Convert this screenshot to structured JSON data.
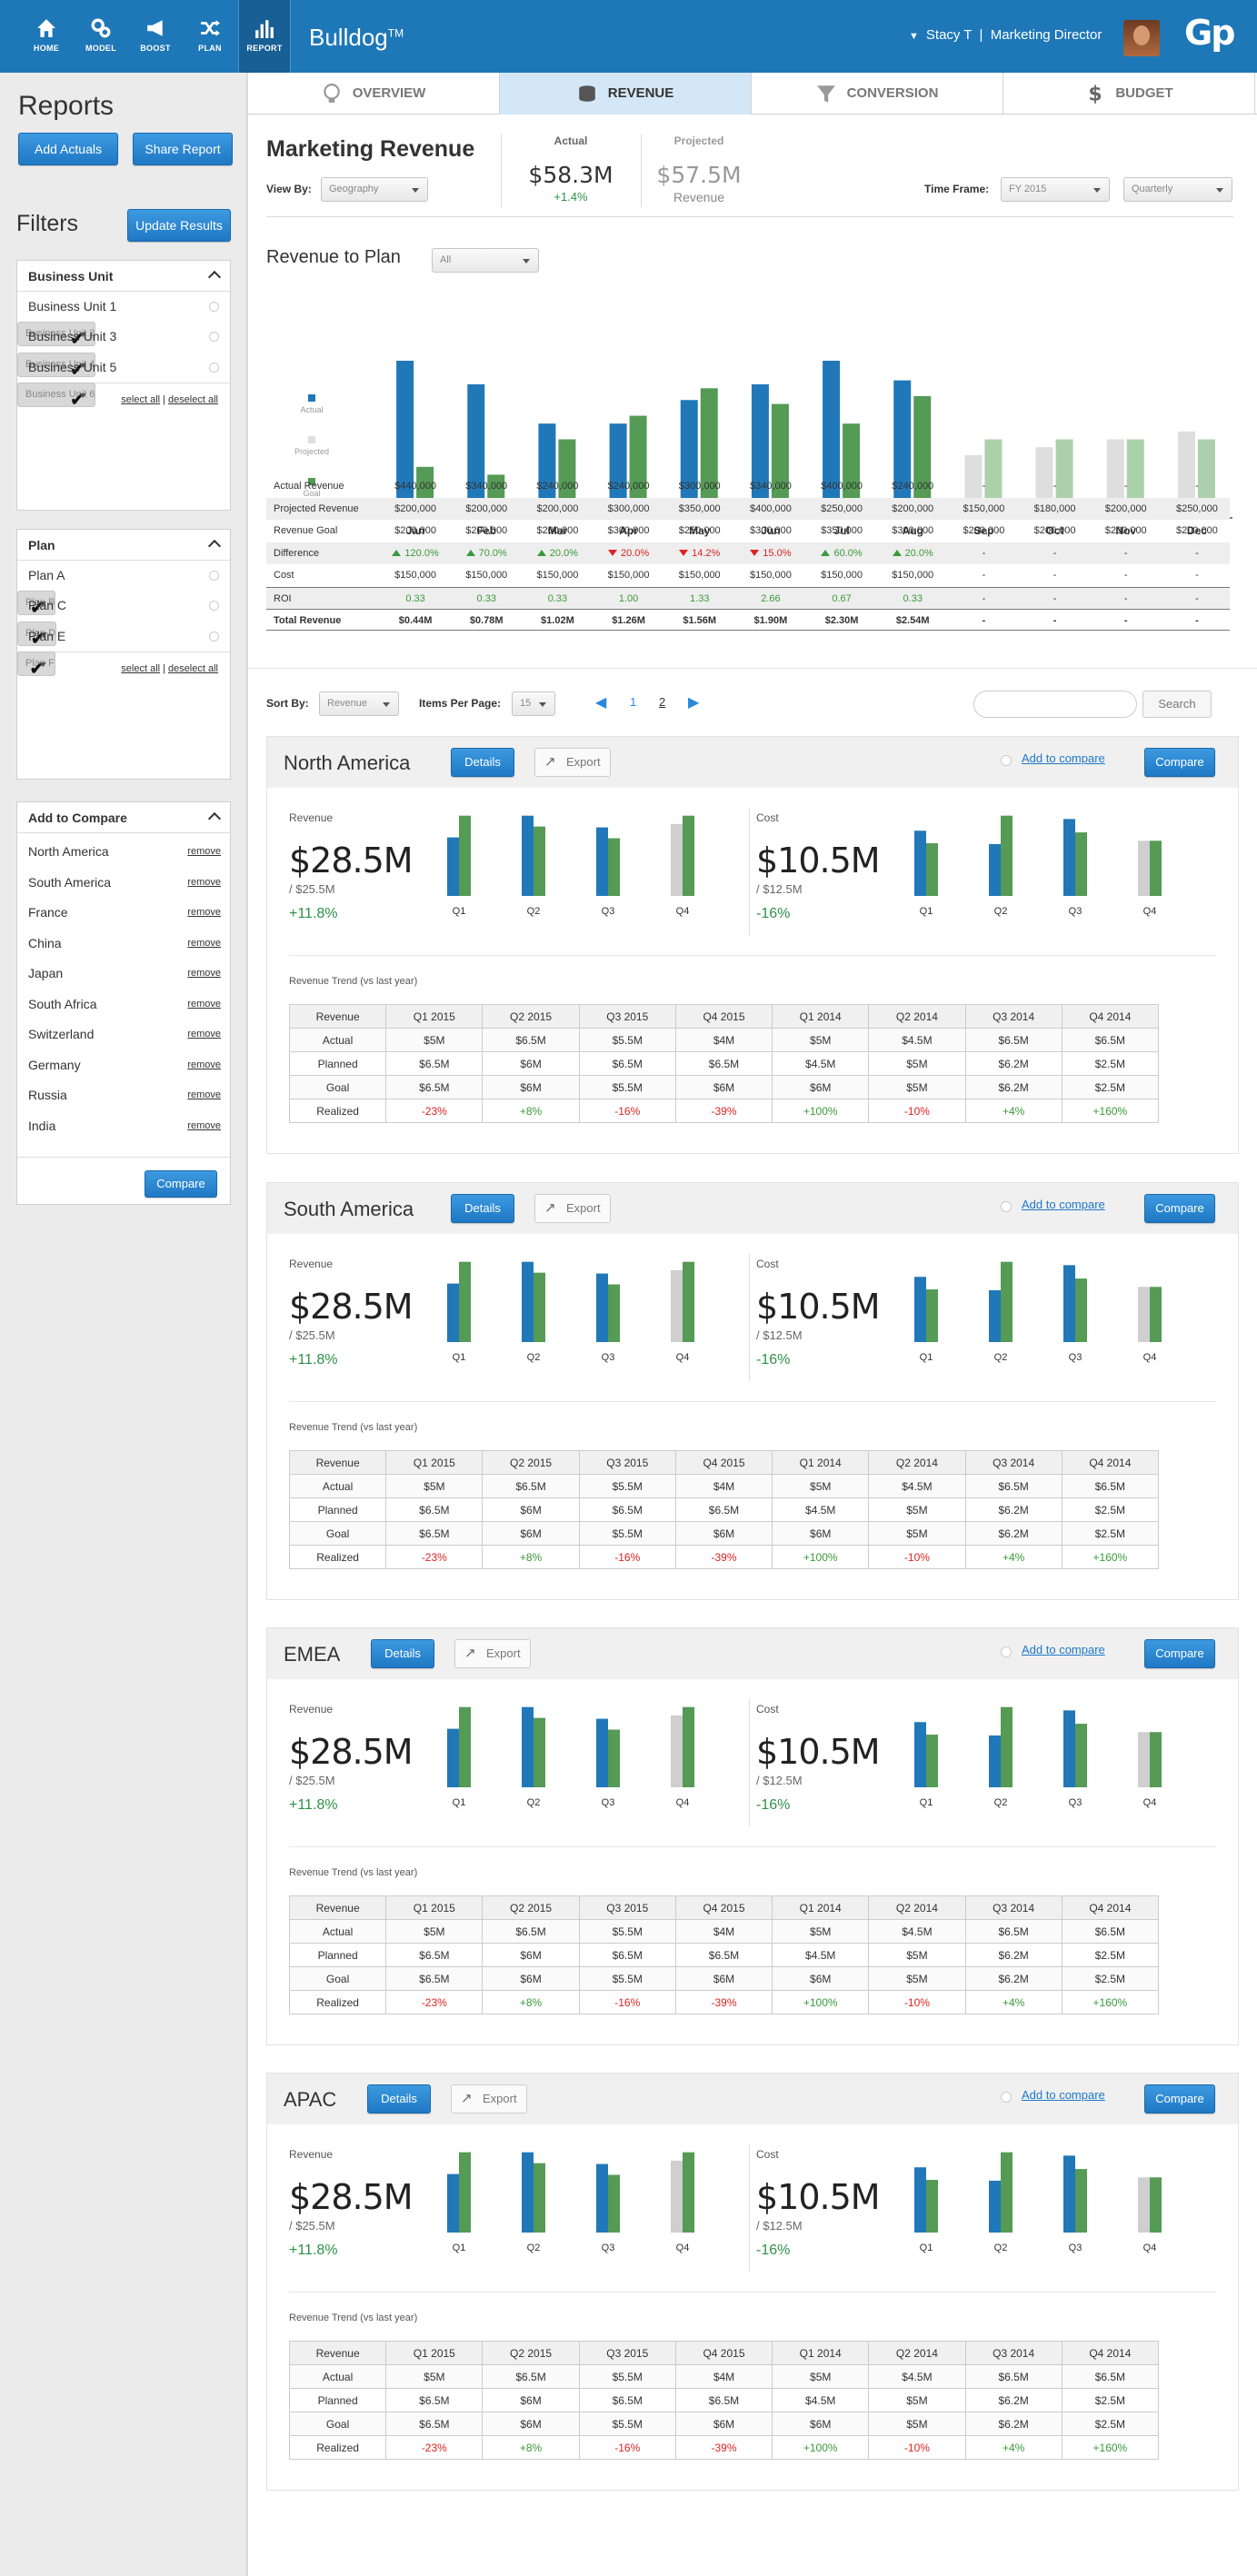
{
  "header": {
    "brand": "Bulldog",
    "brand_tm": "TM",
    "user": "Stacy T",
    "role": "Marketing Director",
    "logo": "Gp",
    "nav": [
      {
        "label": "HOME",
        "icon": "home-icon"
      },
      {
        "label": "MODEL",
        "icon": "model-gears-icon"
      },
      {
        "label": "BOOST",
        "icon": "megaphone-icon"
      },
      {
        "label": "PLAN",
        "icon": "shuffle-icon"
      },
      {
        "label": "REPORT",
        "icon": "bar-chart-icon",
        "active": true
      }
    ]
  },
  "sidebar": {
    "title": "Reports",
    "add_actuals": "Add Actuals",
    "share_report": "Share Report",
    "filters_title": "Filters",
    "update_results": "Update Results",
    "business_unit": {
      "title": "Business Unit",
      "items": [
        {
          "label": "Business Unit 1",
          "checked": false
        },
        {
          "label": "Business Unit 2",
          "checked": true
        },
        {
          "label": "Business Unit 3",
          "checked": false
        },
        {
          "label": "Business Unit 4",
          "checked": true
        },
        {
          "label": "Business Unit 5",
          "checked": false
        },
        {
          "label": "Business Unit 6",
          "checked": true
        }
      ]
    },
    "plan": {
      "title": "Plan",
      "items": [
        {
          "label": "Plan A",
          "checked": false
        },
        {
          "label": "Plan B",
          "checked": true
        },
        {
          "label": "Plan C",
          "checked": false
        },
        {
          "label": "Plan D",
          "checked": true
        },
        {
          "label": "Plan E",
          "checked": false
        },
        {
          "label": "Plan F",
          "checked": true
        }
      ]
    },
    "select_all": "select all",
    "deselect_all": "deselect all",
    "compare": {
      "title": "Add to Compare",
      "remove": "remove",
      "items": [
        "North America",
        "South America",
        "France",
        "China",
        "Japan",
        "South Africa",
        "Switzerland",
        "Germany",
        "Russia",
        "India"
      ],
      "button": "Compare"
    }
  },
  "tabs": [
    {
      "label": "OVERVIEW",
      "icon": "lightbulb-icon"
    },
    {
      "label": "REVENUE",
      "icon": "coins-icon",
      "active": true
    },
    {
      "label": "CONVERSION",
      "icon": "funnel-icon"
    },
    {
      "label": "BUDGET",
      "icon": "dollar-icon"
    }
  ],
  "summary": {
    "title": "Marketing Revenue",
    "view_by_label": "View By:",
    "view_by_value": "Geography",
    "actual_label": "Actual",
    "actual_value": "$58.3M",
    "actual_change": "+1.4%",
    "projected_label": "Projected",
    "projected_value": "$57.5M",
    "projected_sub": "Revenue",
    "timeframe_label": "Time Frame:",
    "timeframe_value": "FY 2015",
    "period_value": "Quarterly"
  },
  "chart_data": {
    "type": "bar",
    "title": "Revenue to Plan",
    "filter_value": "All",
    "categories": [
      "Jan",
      "Feb",
      "Mar",
      "Apr",
      "May",
      "Jun",
      "Jul",
      "Aug",
      "Sep",
      "Oct",
      "Nov",
      "Dec"
    ],
    "ylim": [
      0,
      400000
    ],
    "legend": [
      "Actual",
      "Projected",
      "Goal"
    ],
    "colors": {
      "actual": "#2178b8",
      "projected": "#dedede",
      "goal": "#559a55",
      "goal_future": "#acd0ac"
    },
    "series": [
      {
        "name": "Actual",
        "values": [
          400000,
          340000,
          240000,
          240000,
          300000,
          340000,
          400000,
          350000,
          null,
          null,
          null,
          null
        ]
      },
      {
        "name": "Projected",
        "values": [
          null,
          null,
          null,
          null,
          null,
          null,
          null,
          null,
          160000,
          180000,
          200000,
          220000
        ]
      },
      {
        "name": "Goal",
        "values": [
          130000,
          110000,
          200000,
          260000,
          330000,
          290000,
          240000,
          310000,
          200000,
          200000,
          200000,
          200000
        ]
      }
    ]
  },
  "revenue_table": {
    "rows": [
      {
        "label": "Actual Revenue",
        "values": [
          "$440,000",
          "$340,000",
          "$240,000",
          "$240,000",
          "$300,000",
          "$340,000",
          "$400,000",
          "$240,000",
          "-",
          "-",
          "-",
          "-"
        ]
      },
      {
        "label": "Projected Revenue",
        "values": [
          "$200,000",
          "$200,000",
          "$200,000",
          "$300,000",
          "$350,000",
          "$400,000",
          "$250,000",
          "$200,000",
          "$150,000",
          "$180,000",
          "$200,000",
          "$250,000"
        ],
        "alt": true
      },
      {
        "label": "Revenue Goal",
        "values": [
          "$200,000",
          "$200,000",
          "$200,000",
          "$300,000",
          "$250,000",
          "$300,000",
          "$350,000",
          "$300,000",
          "$200,000",
          "$200,000",
          "$200,000",
          "$200,000"
        ]
      },
      {
        "label": "Difference",
        "diff": true,
        "values": [
          "120.0%",
          "70.0%",
          "20.0%",
          "20.0%",
          "14.2%",
          "15.0%",
          "60.0%",
          "20.0%",
          "-",
          "-",
          "-",
          "-"
        ],
        "dirs": [
          "up",
          "up",
          "up",
          "dn",
          "dn",
          "dn",
          "up",
          "up",
          "",
          "",
          "",
          ""
        ],
        "alt": true
      },
      {
        "label": "Cost",
        "values": [
          "$150,000",
          "$150,000",
          "$150,000",
          "$150,000",
          "$150,000",
          "$150,000",
          "$150,000",
          "$150,000",
          "-",
          "-",
          "-",
          "-"
        ]
      },
      {
        "label": "ROI",
        "roi": true,
        "values": [
          "0.33",
          "0.33",
          "0.33",
          "1.00",
          "1.33",
          "2.66",
          "0.67",
          "0.33",
          "-",
          "-",
          "-",
          "-"
        ],
        "alt": true
      },
      {
        "label": "Total Revenue",
        "bold": true,
        "values": [
          "$0.44M",
          "$0.78M",
          "$1.02M",
          "$1.26M",
          "$1.56M",
          "$1.90M",
          "$2.30M",
          "$2.54M",
          "-",
          "-",
          "-",
          "-"
        ]
      }
    ]
  },
  "listing": {
    "sort_by_label": "Sort By:",
    "sort_by_value": "Revenue",
    "items_per_page_label": "Items Per Page:",
    "items_per_page_value": "15",
    "pages": [
      "1",
      "2"
    ],
    "search_button": "Search"
  },
  "region_common": {
    "details": "Details",
    "export": "Export",
    "add_to_compare": "Add to compare",
    "compare": "Compare",
    "revenue_label": "Revenue",
    "revenue_value": "$28.5M",
    "revenue_target": "/ $25.5M",
    "revenue_change": "+11.8%",
    "cost_label": "Cost",
    "cost_value": "$10.5M",
    "cost_target": "/ $12.5M",
    "cost_change": "-16%",
    "quarters": [
      "Q1",
      "Q2",
      "Q3",
      "Q4"
    ],
    "rev_bars": [
      [
        0.7,
        0.96
      ],
      [
        0.96,
        0.83
      ],
      [
        0.82,
        0.69
      ],
      [
        0.86,
        0.96
      ]
    ],
    "cost_bars": [
      [
        0.78,
        0.63
      ],
      [
        0.62,
        0.96
      ],
      [
        0.92,
        0.76
      ],
      [
        0.66,
        0.66
      ]
    ],
    "trend_label": "Revenue Trend (vs last year)",
    "trend_headers": [
      "Revenue",
      "Q1 2015",
      "Q2 2015",
      "Q3 2015",
      "Q4 2015",
      "Q1 2014",
      "Q2 2014",
      "Q3 2014",
      "Q4 2014"
    ],
    "trend_rows": [
      [
        "Actual",
        "$5M",
        "$6.5M",
        "$5.5M",
        "$4M",
        "$5M",
        "$4.5M",
        "$6.5M",
        "$6.5M"
      ],
      [
        "Planned",
        "$6.5M",
        "$6M",
        "$6.5M",
        "$6.5M",
        "$4.5M",
        "$5M",
        "$6.2M",
        "$2.5M"
      ],
      [
        "Goal",
        "$6.5M",
        "$6M",
        "$5.5M",
        "$6M",
        "$6M",
        "$5M",
        "$6.2M",
        "$2.5M"
      ],
      [
        "Realized",
        "-23%",
        "+8%",
        "-16%",
        "-39%",
        "+100%",
        "-10%",
        "+4%",
        "+160%"
      ]
    ]
  },
  "regions": [
    {
      "name": "North America"
    },
    {
      "name": "South America"
    },
    {
      "name": "EMEA"
    },
    {
      "name": "APAC"
    }
  ]
}
